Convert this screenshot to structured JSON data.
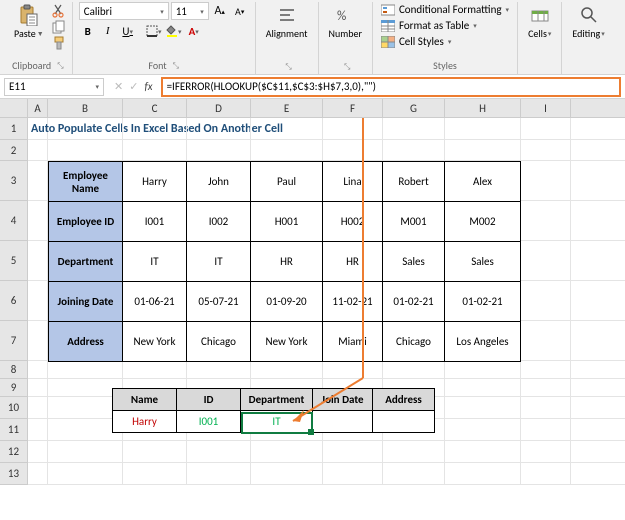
{
  "ribbon": {
    "clipboard": {
      "label": "Clipboard",
      "paste": "Paste"
    },
    "font": {
      "label": "Font",
      "name": "Calibri",
      "size": "11",
      "bold": "B",
      "italic": "I",
      "underline": "U",
      "increase": "A",
      "decrease": "A"
    },
    "alignment": {
      "label": "Alignment"
    },
    "number": {
      "label": "Number"
    },
    "styles": {
      "label": "Styles",
      "conditional": "Conditional Formatting",
      "table": "Format as Table",
      "cell": "Cell Styles"
    },
    "cells": {
      "label": "Cells"
    },
    "editing": {
      "label": "Editing"
    }
  },
  "namebox": "E11",
  "formula": "=IFERROR(HLOOKUP($C$11,$C$3:$H$7,3,0),\"\")",
  "columns": [
    "A",
    "B",
    "C",
    "D",
    "E",
    "F",
    "G",
    "H",
    "I"
  ],
  "rows": [
    "1",
    "2",
    "3",
    "4",
    "5",
    "6",
    "7",
    "8",
    "9",
    "10",
    "11",
    "12",
    "13"
  ],
  "title": "Auto Populate Cells In Excel Based On Another Cell",
  "table": {
    "row_headers": [
      "Employee Name",
      "Employee ID",
      "Department",
      "Joining Date",
      "Address"
    ],
    "data": [
      [
        "Harry",
        "John",
        "Paul",
        "Lina",
        "Robert",
        "Alex"
      ],
      [
        "I001",
        "I002",
        "H001",
        "H002",
        "M001",
        "M002"
      ],
      [
        "IT",
        "IT",
        "HR",
        "HR",
        "Sales",
        "Sales"
      ],
      [
        "01-06-21",
        "05-07-21",
        "01-09-20",
        "11-02-21",
        "01-02-21",
        "01-02-21"
      ],
      [
        "New York",
        "Chicago",
        "New York",
        "Miami",
        "Chicago",
        "Los Angeles"
      ]
    ]
  },
  "lookup": {
    "headers": [
      "Name",
      "ID",
      "Department",
      "Join Date",
      "Address"
    ],
    "values": [
      "Harry",
      "I001",
      "IT",
      "",
      ""
    ]
  }
}
